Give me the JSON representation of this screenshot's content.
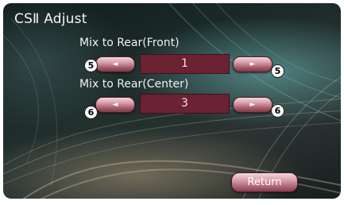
{
  "screen": {
    "title": "CSⅡ Adjust"
  },
  "rows": [
    {
      "label": "Mix to Rear(Front)",
      "value": "1",
      "left_arrow": "◄",
      "right_arrow": "►",
      "badge": "5"
    },
    {
      "label": "Mix to Rear(Center)",
      "value": "3",
      "left_arrow": "◄",
      "right_arrow": "►",
      "badge": "6"
    }
  ],
  "footer": {
    "return_label": "Return"
  },
  "colors": {
    "value_box": "#6b2233",
    "button_pink": "#d9a0ac"
  }
}
